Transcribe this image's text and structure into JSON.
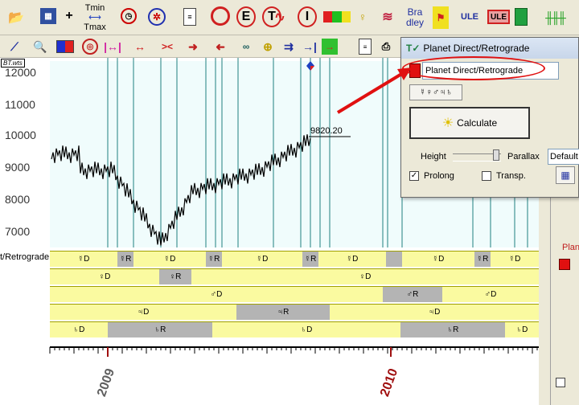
{
  "toolbar1": {
    "tmin": "Tmin",
    "tmax": "Tmax",
    "e_label": "E",
    "t_label": "T",
    "bradley_1": "Bra",
    "bradley_2": "dley",
    "ule1": "ULE",
    "ule2": "ULE"
  },
  "chart": {
    "tag": "BT.wts",
    "y_ticks": [
      "12000",
      "11000",
      "10000",
      "9000",
      "8000",
      "7000"
    ],
    "last_value": "9820.20",
    "years": [
      "2009",
      "2010"
    ],
    "row_title": "t/Retrograde"
  },
  "rows": [
    {
      "name": "mercury",
      "segments": [
        {
          "x": 0,
          "w": 84,
          "label": "☿D",
          "retro": false
        },
        {
          "x": 84,
          "w": 20,
          "label": "☿R",
          "retro": true
        },
        {
          "x": 104,
          "w": 90,
          "label": "☿D",
          "retro": false
        },
        {
          "x": 194,
          "w": 20,
          "label": "☿R",
          "retro": true
        },
        {
          "x": 214,
          "w": 100,
          "label": "☿D",
          "retro": false
        },
        {
          "x": 314,
          "w": 20,
          "label": "☿R",
          "retro": true
        },
        {
          "x": 334,
          "w": 84,
          "label": "☿D",
          "retro": false
        },
        {
          "x": 418,
          "w": 20,
          "label": "",
          "retro": true
        },
        {
          "x": 438,
          "w": 90,
          "label": "☿D",
          "retro": false
        },
        {
          "x": 528,
          "w": 20,
          "label": "☿R",
          "retro": true
        },
        {
          "x": 548,
          "w": 60,
          "label": "☿D",
          "retro": false
        }
      ]
    },
    {
      "name": "venus",
      "segments": [
        {
          "x": 0,
          "w": 136,
          "label": "♀D",
          "retro": false
        },
        {
          "x": 136,
          "w": 40,
          "label": "♀R",
          "retro": true
        },
        {
          "x": 176,
          "w": 432,
          "label": "♀D",
          "retro": false
        }
      ]
    },
    {
      "name": "mars",
      "segments": [
        {
          "x": 0,
          "w": 414,
          "label": "♂D",
          "retro": false
        },
        {
          "x": 414,
          "w": 74,
          "label": "♂R",
          "retro": true
        },
        {
          "x": 488,
          "w": 120,
          "label": "♂D",
          "retro": false
        }
      ]
    },
    {
      "name": "jupiter",
      "segments": [
        {
          "x": 0,
          "w": 232,
          "label": "♃D",
          "retro": false
        },
        {
          "x": 232,
          "w": 116,
          "label": "♃R",
          "retro": true
        },
        {
          "x": 348,
          "w": 260,
          "label": "♃D",
          "retro": false
        }
      ]
    },
    {
      "name": "saturn",
      "segments": [
        {
          "x": 0,
          "w": 72,
          "label": "♄D",
          "retro": false
        },
        {
          "x": 72,
          "w": 130,
          "label": "♄R",
          "retro": true
        },
        {
          "x": 202,
          "w": 234,
          "label": "♄D",
          "retro": false
        },
        {
          "x": 436,
          "w": 130,
          "label": "♄R",
          "retro": true
        },
        {
          "x": 566,
          "w": 42,
          "label": "♄D",
          "retro": false
        }
      ]
    }
  ],
  "dialog": {
    "title": "Planet Direct/Retrograde",
    "field": "Planet Direct/Retrograde",
    "planets": "☿♀♂♃♄",
    "calculate": "Calculate",
    "height_label": "Height",
    "parallax_label": "Parallax",
    "parallax_value": "Default",
    "prolong": "Prolong",
    "transp": "Transp."
  },
  "rightpanel": {
    "label": "Plan"
  },
  "colors": {
    "accent_red": "#e01010",
    "row_yellow": "#fafaa0",
    "retro_gray": "#b4b4b4",
    "line_teal": "#208080"
  }
}
